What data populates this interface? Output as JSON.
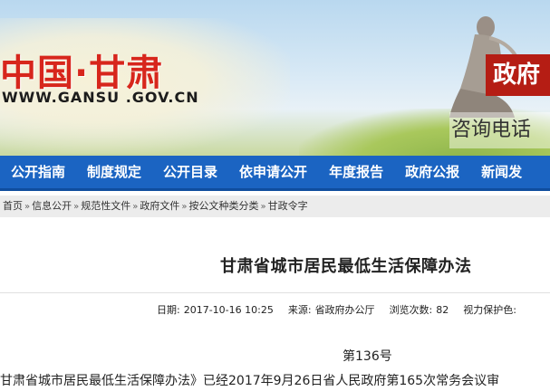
{
  "header": {
    "logo_text": "中国·甘肃",
    "logo_url": "WWW.GANSU .GOV.CN",
    "gov_label": "政府",
    "hotline": "咨询电话"
  },
  "nav": {
    "items": [
      {
        "label": "公开指南"
      },
      {
        "label": "制度规定"
      },
      {
        "label": "公开目录"
      },
      {
        "label": "依申请公开"
      },
      {
        "label": "年度报告"
      },
      {
        "label": "政府公报"
      },
      {
        "label": "新闻发"
      }
    ]
  },
  "breadcrumb": {
    "items": [
      "首页",
      "信息公开",
      "规范性文件",
      "政府文件",
      "按公文种类分类",
      "甘政令字"
    ],
    "separator": "»"
  },
  "article": {
    "title": "甘肃省城市居民最低生活保障办法",
    "meta": {
      "date_label": "日期:",
      "date": "2017-10-16 10:25",
      "source_label": "来源:",
      "source": "省政府办公厅",
      "views_label": "浏览次数:",
      "views": "82",
      "vision_label": "视力保护色:"
    },
    "doc_number": "第136号",
    "body_first_line": "甘肃省城市居民最低生活保障办法》已经2017年9月26日省人民政府第165次常务会议审"
  },
  "colors": {
    "nav_bg": "#1b64c2",
    "logo_red": "#d7261c",
    "gov_label_bg": "#b51d14",
    "breadcrumb_bg": "#ececec"
  }
}
